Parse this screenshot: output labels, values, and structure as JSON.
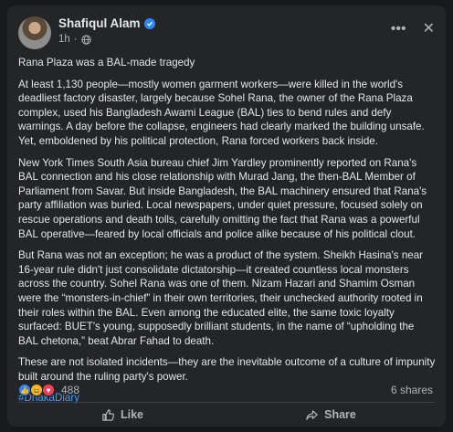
{
  "post": {
    "author": "Shafiqul Alam",
    "time": "1h",
    "title_line": "Rana Plaza was a BAL-made tragedy",
    "paragraphs": [
      "At least 1,130 people—mostly women garment workers—were killed in the world's deadliest factory disaster, largely because Sohel Rana, the owner of the Rana Plaza complex, used his Bangladesh Awami League (BAL) ties to bend rules and defy warnings. A day before the collapse, engineers had clearly marked the building unsafe. Yet, emboldened by his political protection, Rana forced workers back inside.",
      "New York Times South Asia bureau chief Jim Yardley prominently reported on Rana's BAL connection and his close relationship with Murad Jang, the then-BAL Member of Parliament from Savar. But inside Bangladesh, the BAL machinery ensured that Rana's party affiliation was buried. Local newspapers, under quiet pressure, focused solely on rescue operations and death tolls, carefully omitting the fact that Rana was a powerful BAL operative—feared by local officials and police alike because of his political clout.",
      "But Rana was not an exception; he was a product of the system. Sheikh Hasina's near 16-year rule didn't just consolidate dictatorship—it created countless local monsters across the country. Sohel Rana was one of them. Nizam Hazari and Shamim Osman were the “monsters-in-chief” in their own territories, their unchecked authority rooted in their roles within the BAL. Even among the educated elite, the same toxic loyalty surfaced: BUET's young, supposedly brilliant students, in the name of “upholding the BAL chetona,” beat Abrar Fahad to death.",
      "These are not isolated incidents—they are the inevitable outcome of a culture of impunity built around the ruling party's power."
    ],
    "hashtag": "#DhakaDiary",
    "reaction_count": "488",
    "shares": "6 shares"
  },
  "actions": {
    "like": "Like",
    "share": "Share"
  },
  "icons": {
    "more": "more-dots-icon",
    "close": "close-icon",
    "globe": "globe-icon",
    "like": "thumbs-up-icon",
    "share": "share-arrow-icon"
  },
  "colors": {
    "background": "#18191a",
    "card": "#242526",
    "link": "#4599ff",
    "verified": "#2d88ff"
  }
}
